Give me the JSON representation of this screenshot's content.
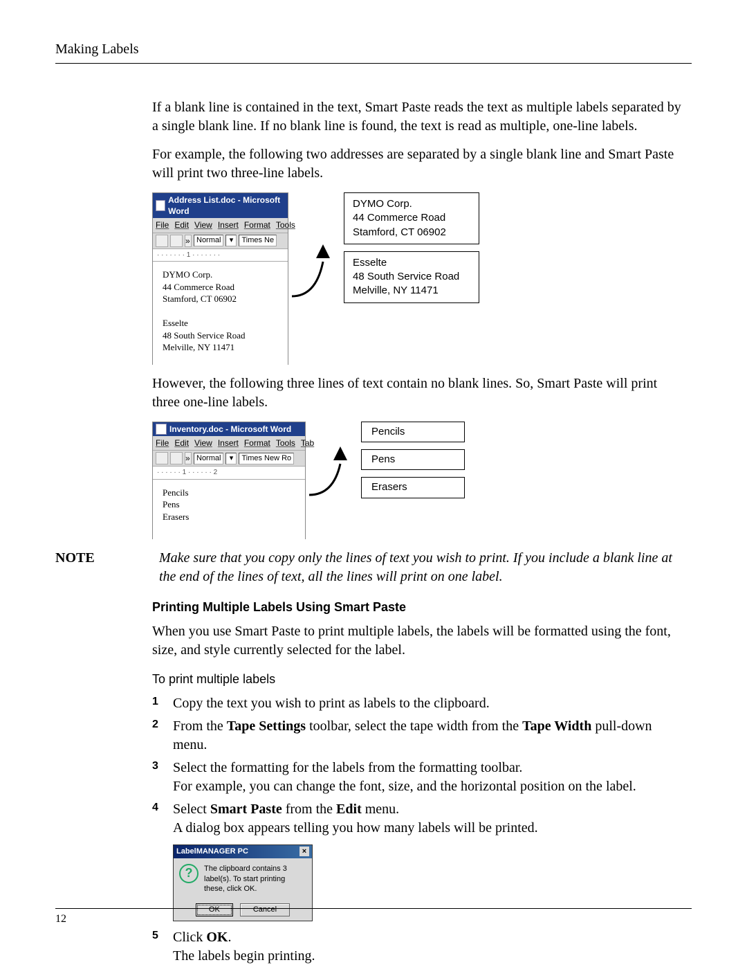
{
  "header": "Making Labels",
  "intro_p1": "If a blank line is contained in the text, Smart Paste reads the text as multiple labels separated by a single blank line. If no blank line is found, the text is read as multiple, one-line labels.",
  "intro_p2": "For example, the following two addresses are separated by a single blank line and Smart Paste will print two three-line labels.",
  "word1": {
    "title": "Address List.doc - Microsoft Word",
    "menu": [
      "File",
      "Edit",
      "View",
      "Insert",
      "Format",
      "Tools"
    ],
    "style": "Normal",
    "font": "Times Ne",
    "ruler": "· · · · · · · 1 · · · · · · ·",
    "doc_lines": [
      "DYMO Corp.",
      "44 Commerce Road",
      "Stamford, CT 06902",
      "",
      "Esselte",
      "48 South Service Road",
      "Melville, NY 11471"
    ]
  },
  "labels1": [
    [
      "DYMO Corp.",
      "44 Commerce Road",
      "Stamford, CT 06902"
    ],
    [
      "Esselte",
      "48 South Service Road",
      "Melville, NY 11471"
    ]
  ],
  "intro_p3": "However, the following three lines of text contain no blank lines. So, Smart Paste will print three one-line labels.",
  "word2": {
    "title": "Inventory.doc - Microsoft Word",
    "menu": [
      "File",
      "Edit",
      "View",
      "Insert",
      "Format",
      "Tools",
      "Tab"
    ],
    "style": "Normal",
    "font": "Times New Ro",
    "ruler": "· · · · · · 1 · · · · · · 2",
    "doc_lines": [
      "Pencils",
      "Pens",
      "Erasers"
    ]
  },
  "labels2": [
    "Pencils",
    "Pens",
    "Erasers"
  ],
  "note_label": "NOTE",
  "note_text": "Make sure that you copy only the lines of text you wish to print. If you include a blank line at the end of the lines of text, all the lines will print on one label.",
  "subhead": "Printing Multiple Labels Using Smart Paste",
  "sub_intro": "When you use Smart Paste to print multiple labels, the labels will be formatted using the font, size, and style currently selected for the label.",
  "to_head": "To print multiple labels",
  "steps": [
    {
      "n": "1",
      "html": "Copy the text you wish to print as labels to the clipboard."
    },
    {
      "n": "2",
      "html": "From the <b>Tape Settings</b> toolbar, select the tape width from the <b>Tape Width</b> pull-down menu."
    },
    {
      "n": "3",
      "html": "Select the formatting for the labels from the formatting toolbar.<br>For example, you can change the font, size, and the horizontal position on the label."
    },
    {
      "n": "4",
      "html": "Select <b>Smart Paste</b> from the <b>Edit</b> menu.<br>A dialog box appears telling you how many labels will be printed."
    }
  ],
  "dialog": {
    "title": "LabelMANAGER PC",
    "msg": "The clipboard contains 3 label(s). To start printing these, click OK.",
    "ok": "OK",
    "cancel": "Cancel"
  },
  "step5": {
    "n": "5",
    "html": "Click <b>OK</b>.<br>The labels begin printing."
  },
  "page_num": "12"
}
